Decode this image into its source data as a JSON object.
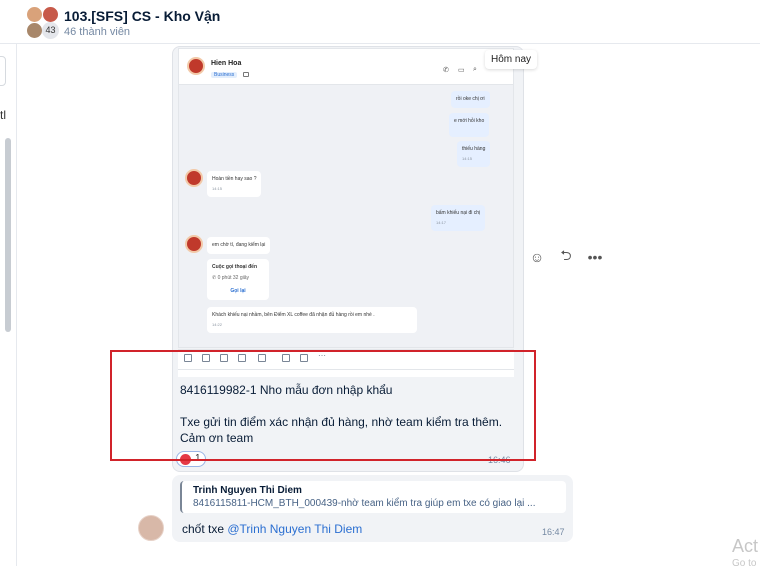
{
  "header": {
    "title": "103.[SFS] CS - Kho Vận",
    "subtitle": "46 thành viên",
    "member_overflow": "43"
  },
  "left_sidebar": {
    "partial_char": "tl"
  },
  "image_message": {
    "today_badge": "Hôm nay",
    "inner": {
      "contact_name": "Hien Hoa",
      "contact_tag": "Business",
      "messages": [
        {
          "text": "rồi oke chị ơi",
          "time": "",
          "mine": true
        },
        {
          "text": "e mới hỏi kho",
          "time": "",
          "mine": true
        },
        {
          "text": "thiếu hàng",
          "time": "14:15",
          "mine": true
        },
        {
          "text": "Hoàn tiền hay sao ?",
          "time": "14:15",
          "mine": false
        },
        {
          "text": "bấm khiếu nại đi chị",
          "time": "14:17",
          "mine": true
        },
        {
          "text": "em chờ tí, đang kiểm lại",
          "time": "",
          "mine": false
        }
      ],
      "call_card": {
        "title": "Cuộc gọi thoại đến",
        "duration": "0 phút 32 giây",
        "action": "Gọi lại"
      },
      "long_message": {
        "text": "Khách khiếu nại nhầm, bên Điểm XL coffee đã nhận đủ hàng rồi em nhé .",
        "time": "14:22"
      }
    },
    "text_lines": [
      "8416119982-1 Nho mẫu đơn nhập khẩu",
      "Txe gửi tin điểm xác nhận đủ hàng, nhờ team kiểm tra thêm.",
      "Cảm ơn team"
    ],
    "reaction_count": "1",
    "time": "16:46"
  },
  "reply_message": {
    "quote_author": "Trinh Nguyen Thi Diem",
    "quote_text": "8416115811-HCM_BTH_000439-nhờ team kiểm tra giúp em txe có giao lại ...",
    "text": "chốt txe ",
    "mention": "@Trinh Nguyen Thi Diem",
    "time": "16:47"
  },
  "watermark": {
    "line1": "Act",
    "line2": "Go to"
  },
  "colors": {
    "highlight_box": "#d1232a",
    "mention": "#2b6fd1",
    "reaction_heart": "#e53946"
  }
}
